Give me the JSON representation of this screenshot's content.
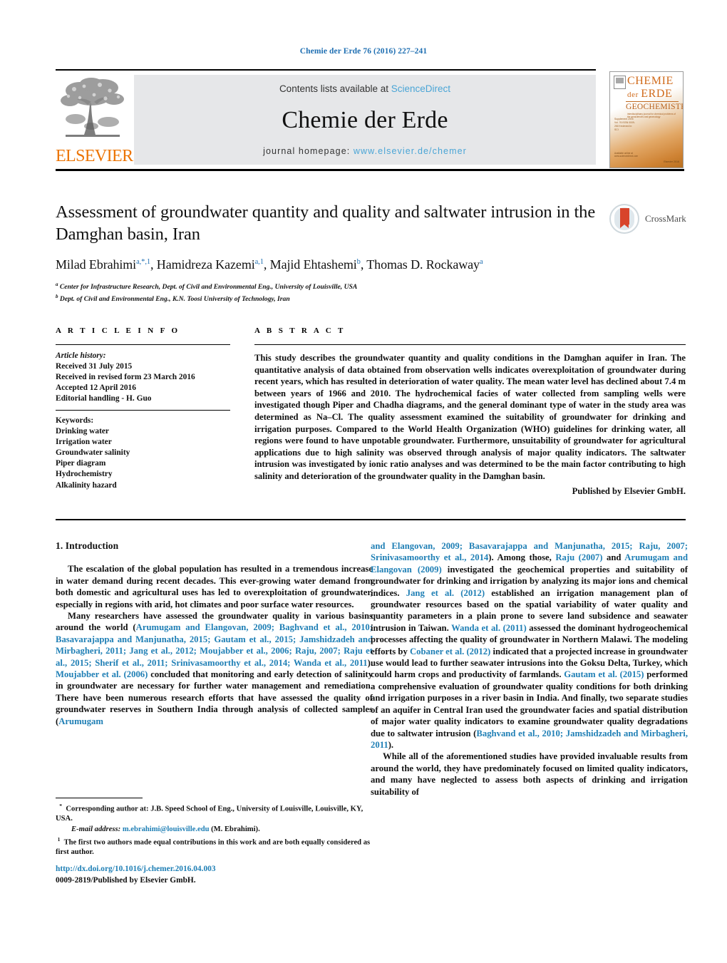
{
  "running_head": "Chemie der Erde 76 (2016) 227–241",
  "masthead": {
    "contents_prefix": "Contents lists available at ",
    "sciencedirect": "ScienceDirect",
    "journal_title": "Chemie der Erde",
    "homepage_prefix": "journal homepage: ",
    "homepage_url": "www.elsevier.de/chemer",
    "publisher_logo_text": "ELSEVIER",
    "accent_link_color": "#4aa5d6",
    "elsevier_orange": "#ec7404"
  },
  "cover": {
    "line1": "CHEMIE",
    "line2_small": "der ",
    "line2_big": "ERDE",
    "line3": "GEOCHEMISTRY",
    "subtitle": "interdisciplinary journal for chemical problems of the geosciences and geoecology",
    "left_block": "Supplement 2016\nVol. 76\nISSN 0009-2819\nIndexed in: SCI",
    "bottom_left": "Available online at\nwww.sciencedirect.com",
    "bottom_right": "Elsevier\n2016"
  },
  "article": {
    "title": "Assessment of groundwater quantity and quality and saltwater intrusion in the Damghan basin, Iran",
    "authors_html": "Milad Ebrahimi<sup>a,*,1</sup>, Hamidreza Kazemi<sup>a,1</sup>, Majid Ehtashemi<sup>b</sup>, Thomas D. Rockaway<sup>a</sup>",
    "affiliation_a": "Center for Infrastructure Research, Dept. of Civil and Environmental Eng., University of Louisville, USA",
    "affiliation_b": "Dept. of Civil and Environmental Eng., K.N. Toosi University of Technology, Iran",
    "crossmark_label": "CrossMark"
  },
  "article_info": {
    "heading": "A R T I C L E   I N F O",
    "history_label": "Article history:",
    "received": "Received 31 July 2015",
    "revised": "Received in revised form 23 March 2016",
    "accepted": "Accepted 12 April 2016",
    "editorial": "Editorial handling - H. Guo",
    "keywords_label": "Keywords:",
    "keywords": [
      "Drinking water",
      "Irrigation water",
      "Groundwater salinity",
      "Piper diagram",
      "Hydrochemistry",
      "Alkalinity hazard"
    ]
  },
  "abstract": {
    "heading": "A B S T R A C T",
    "text": "This study describes the groundwater quantity and quality conditions in the Damghan aquifer in Iran. The quantitative analysis of data obtained from observation wells indicates overexploitation of groundwater during recent years, which has resulted in deterioration of water quality. The mean water level has declined about 7.4 m between years of 1966 and 2010. The hydrochemical facies of water collected from sampling wells were investigated though Piper and Chadha diagrams, and the general dominant type of water in the study area was determined as Na–Cl. The quality assessment examined the suitability of groundwater for drinking and irrigation purposes. Compared to the World Health Organization (WHO) guidelines for drinking water, all regions were found to have unpotable groundwater. Furthermore, unsuitability of groundwater for agricultural applications due to high salinity was observed through analysis of major quality indicators. The saltwater intrusion was investigated by ionic ratio analyses and was determined to be the main factor contributing to high salinity and deterioration of the groundwater quality in the Damghan basin.",
    "published_by": "Published by Elsevier GmbH."
  },
  "body": {
    "section_heading": "1. Introduction",
    "left_p1": "The escalation of the global population has resulted in a tremendous increase in water demand during recent decades. This ever-growing water demand from both domestic and agricultural uses has led to overexploitation of groundwater, especially in regions with arid, hot climates and poor surface water resources.",
    "left_p2_a": "Many researchers have assessed the groundwater quality in various basins around the world (",
    "left_p2_refs1": "Arumugam and Elangovan, 2009; Baghvand et al., 2010; Basavarajappa and Manjunatha, 2015; Gautam et al., 2015; Jamshidzadeh and Mirbagheri, 2011; Jang et al., 2012; Moujabber et al., 2006; Raju, 2007; Raju et al., 2015; Sherif et al., 2011; Srinivasamoorthy et al., 2014; Wanda et al., 2011",
    "left_p2_b": "). ",
    "left_p2_refs2": "Moujabber et al. (2006)",
    "left_p2_c": " concluded that monitoring and early detection of salinity in groundwater are necessary for further water management and remediation. There have been numerous research efforts that have assessed the quality of groundwater reserves in Southern India through analysis of collected samples (",
    "left_p2_refs3": "Arumugam",
    "right_p1_refs1": "and Elangovan, 2009; Basavarajappa and Manjunatha, 2015; Raju, 2007; Srinivasamoorthy et al., 2014",
    "right_p1_a": "). Among those, ",
    "right_p1_refs2": "Raju (2007)",
    "right_p1_b": " and ",
    "right_p1_refs3": "Arumugam and Elangovan (2009)",
    "right_p1_c": " investigated the geochemical properties and suitability of groundwater for drinking and irrigation by analyzing its major ions and chemical indices. ",
    "right_p1_refs4": "Jang et al. (2012)",
    "right_p1_d": " established an irrigation management plan of groundwater resources based on the spatial variability of water quality and quantity parameters in a plain prone to severe land subsidence and seawater intrusion in Taiwan. ",
    "right_p1_refs5": "Wanda et al. (2011)",
    "right_p1_e": " assessed the dominant hydrogeochemical processes affecting the quality of groundwater in Northern Malawi. The modeling efforts by ",
    "right_p1_refs6": "Cobaner et al. (2012)",
    "right_p1_f": " indicated that a projected increase in groundwater use would lead to further seawater intrusions into the Goksu Delta, Turkey, which could harm crops and productivity of farmlands. ",
    "right_p1_refs7": "Gautam et al. (2015)",
    "right_p1_g": " performed a comprehensive evaluation of groundwater quality conditions for both drinking and irrigation purposes in a river basin in India. And finally, two separate studies of an aquifer in Central Iran used the groundwater facies and spatial distribution of major water quality indicators to examine groundwater quality degradations due to saltwater intrusion (",
    "right_p1_refs8": "Baghvand et al., 2010; Jamshidzadeh and Mirbagheri, 2011",
    "right_p1_h": ").",
    "right_p2": "While all of the aforementioned studies have provided invaluable results from around the world, they have predominately focused on limited quality indicators, and many have neglected to assess both aspects of drinking and irrigation suitability of"
  },
  "footnotes": {
    "corresponding_marker": "*",
    "corresponding": "Corresponding author at: J.B. Speed School of Eng., University of Louisville, Louisville, KY, USA.",
    "email_label": "E-mail address:",
    "email": "m.ebrahimi@louisville.edu",
    "email_suffix": "(M. Ebrahimi).",
    "note_marker": "1",
    "note": "The first two authors made equal contributions in this work and are both equally considered as first author."
  },
  "doi": {
    "url": "http://dx.doi.org/10.1016/j.chemer.2016.04.003",
    "issn_line": "0009-2819/Published by Elsevier GmbH."
  }
}
